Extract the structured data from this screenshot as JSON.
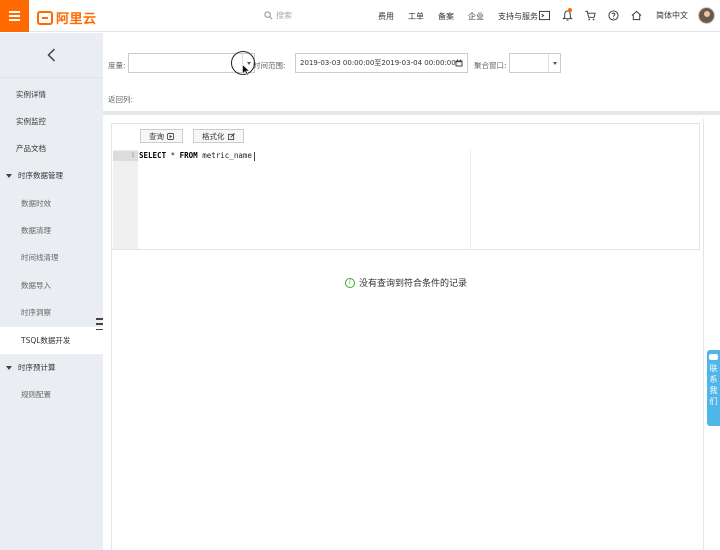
{
  "topbar": {
    "logo_text": "阿里云",
    "search_placeholder": "搜索",
    "nav": [
      "费用",
      "工单",
      "备案",
      "企业",
      "支持与服务"
    ],
    "language": "简体中文",
    "icons": [
      "terminal-icon",
      "bell-icon",
      "cart-icon",
      "help-icon",
      "home-icon"
    ],
    "accent_color": "#ff6a00"
  },
  "sidebar": {
    "items": [
      {
        "label": "实例详情",
        "type": "item"
      },
      {
        "label": "实例监控",
        "type": "item"
      },
      {
        "label": "产品文档",
        "type": "item"
      },
      {
        "label": "时序数据管理",
        "type": "group"
      },
      {
        "label": "数据时效",
        "type": "sub"
      },
      {
        "label": "数据清理",
        "type": "sub"
      },
      {
        "label": "时间线清理",
        "type": "sub"
      },
      {
        "label": "数据导入",
        "type": "sub"
      },
      {
        "label": "时序洞察",
        "type": "sub"
      },
      {
        "label": "TSQL数据开发",
        "type": "sub",
        "active": true
      },
      {
        "label": "时序预计算",
        "type": "group"
      },
      {
        "label": "规则配置",
        "type": "sub"
      }
    ]
  },
  "filters": {
    "metric_label": "度量:",
    "time_range_label": "时间范围:",
    "time_range_value": "2019-03-03 00:00:00至2019-03-04 00:00:00",
    "agg_window_label": "聚合窗口:",
    "return_columns_label": "返回列:"
  },
  "editor": {
    "query_button": "查询",
    "format_button": "格式化",
    "line_number": "1",
    "sql_select": "SELECT",
    "sql_star": "*",
    "sql_from": "FROM",
    "sql_table": "metric_name"
  },
  "result": {
    "empty_message": "没有查询到符合条件的记录"
  },
  "contact_tab": {
    "chars": [
      "联",
      "系",
      "我",
      "们"
    ]
  }
}
